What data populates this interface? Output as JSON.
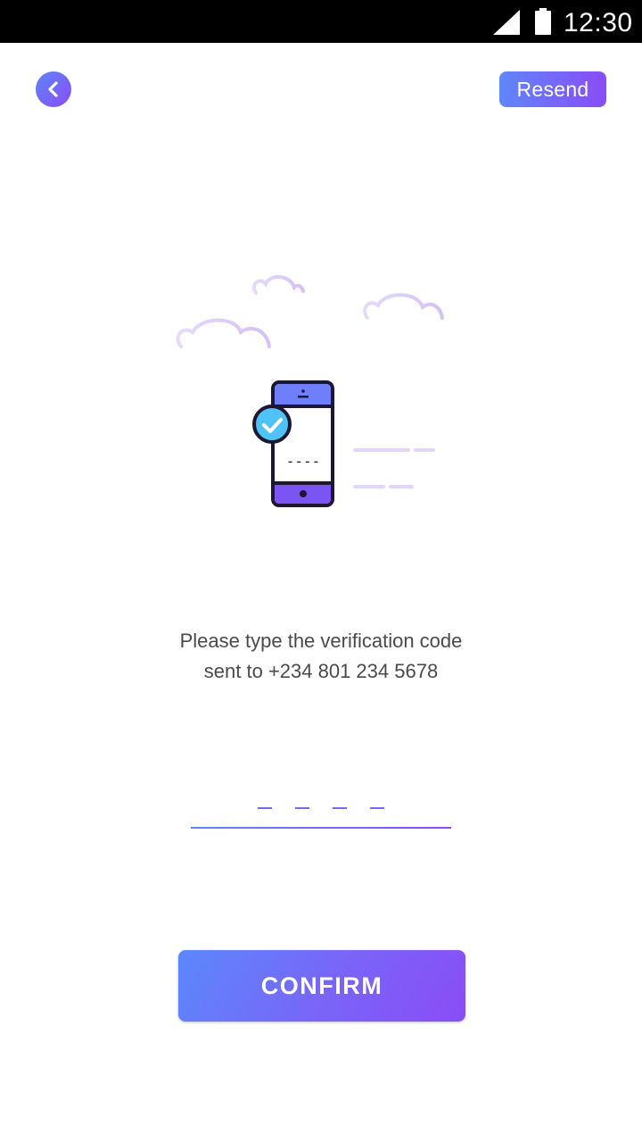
{
  "status_bar": {
    "time": "12:30",
    "icons": [
      "signal-icon",
      "battery-icon"
    ]
  },
  "header": {
    "back_icon": "chevron-left-icon",
    "resend_label": "Resend"
  },
  "illustration": {
    "name": "phone-verified-illustration",
    "phone_screen_text": "----"
  },
  "message": {
    "line1": "Please type the verification code",
    "line2": "sent to +234 801 234 5678"
  },
  "code_input": {
    "value": "",
    "length": 4
  },
  "confirm": {
    "label": "CONFIRM"
  },
  "colors": {
    "gradient_start": "#5f86fa",
    "gradient_end": "#8a4cf6",
    "text": "#4a4a4a",
    "check_blue": "#4fc3f7"
  }
}
